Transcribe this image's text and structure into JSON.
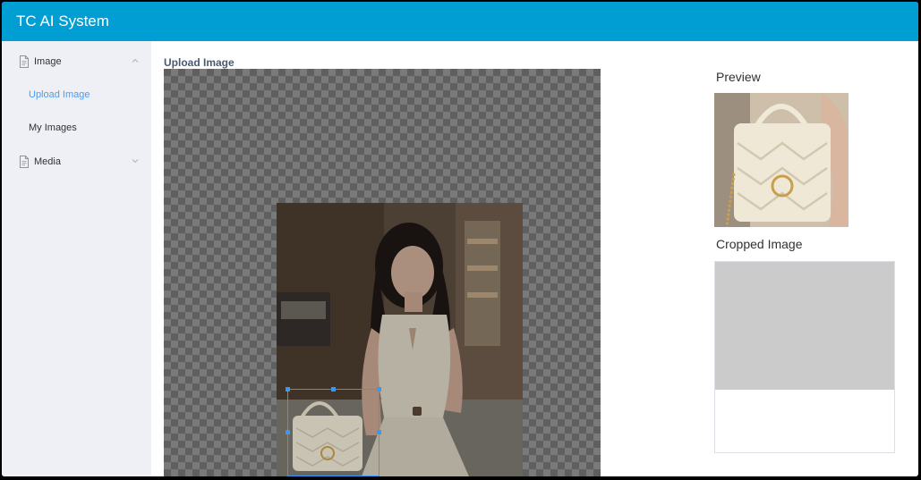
{
  "app": {
    "title": "TC AI System"
  },
  "sidebar": {
    "groups": [
      {
        "label": "Image",
        "expanded": true,
        "items": [
          {
            "label": "Upload Image",
            "active": true
          },
          {
            "label": "My Images",
            "active": false
          }
        ]
      },
      {
        "label": "Media",
        "expanded": false,
        "items": []
      }
    ]
  },
  "main": {
    "title": "Upload Image",
    "preview_label": "Preview",
    "cropped_label": "Cropped Image"
  },
  "colors": {
    "header": "#009ed3",
    "active_link": "#409eff",
    "crop_border": "#3399ff"
  }
}
